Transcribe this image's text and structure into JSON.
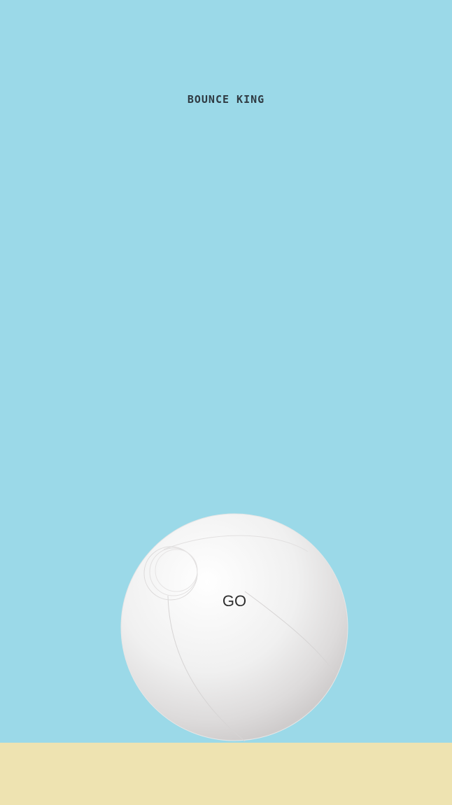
{
  "game": {
    "title": "BOUNCE KING",
    "button_label": "GO"
  },
  "colors": {
    "sky": "#9bd9e8",
    "ground": "#eee3b1",
    "ball": "#ececec",
    "text": "#2f3a42"
  },
  "icons": {
    "ball": "beach-ball"
  }
}
